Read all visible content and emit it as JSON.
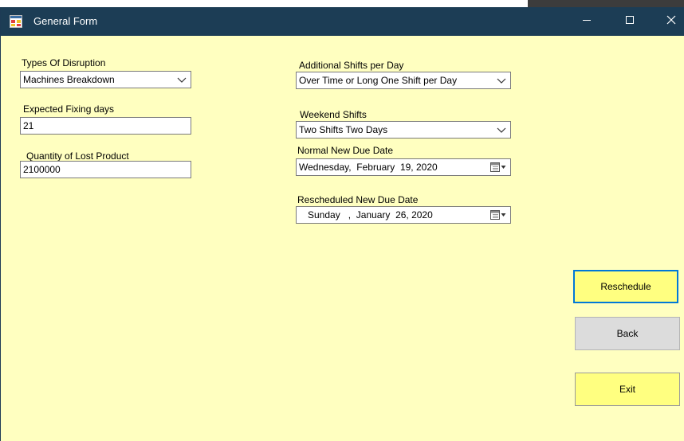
{
  "window": {
    "title": "General Form"
  },
  "titlebar": {
    "minimize_icon": "minimize-icon",
    "maximize_icon": "maximize-icon",
    "close_icon": "close-icon",
    "color": "#1c3d55"
  },
  "form": {
    "background": "#ffffc0",
    "disruption_type": {
      "label": "Types Of Disruption",
      "value": "Machines Breakdown"
    },
    "fixing_days": {
      "label": "Expected Fixing days",
      "value": "21"
    },
    "lost_quantity": {
      "label": "Quantity of Lost Product",
      "value": "2100000"
    },
    "additional_shifts": {
      "label": "Additional Shifts per Day",
      "value": "Over Time or Long One Shift per Day"
    },
    "weekend_shifts": {
      "label": "Weekend Shifts",
      "value": "Two Shifts Two Days"
    },
    "normal_due_date": {
      "label": "Normal New Due Date",
      "value": "Wednesday,  February  19, 2020"
    },
    "rescheduled_due_date": {
      "label": "Rescheduled New Due Date",
      "value": "Sunday   ,  January  26, 2020"
    }
  },
  "buttons": {
    "reschedule": "Reschedule",
    "back": "Back",
    "exit": "Exit"
  }
}
